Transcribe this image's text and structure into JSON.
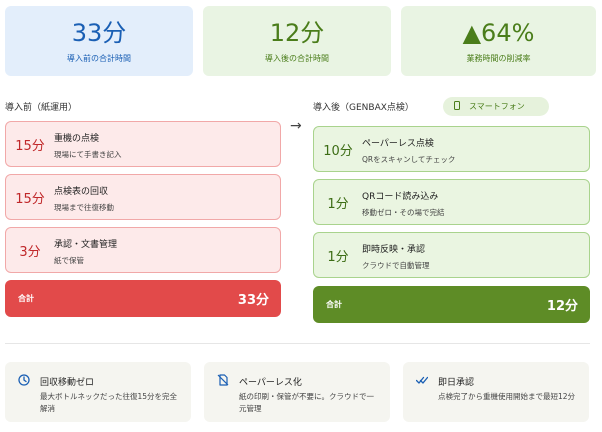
{
  "stats": {
    "before": {
      "value": "33分",
      "caption": "導入前の合計時間"
    },
    "after": {
      "value": "12分",
      "caption": "導入後の合計時間"
    },
    "rate": {
      "value": "▲64%",
      "caption": "業務時間の削減率"
    }
  },
  "before": {
    "title": "導入前（紙運用）",
    "steps": [
      {
        "minutes": "15分",
        "name": "重機の点検",
        "note": "現場にて手書き記入"
      },
      {
        "minutes": "15分",
        "name": "点検表の回収",
        "note": "現場まで往復移動"
      },
      {
        "minutes": "3分",
        "name": "承認・文書管理",
        "note": "紙で保管"
      }
    ],
    "total_label": "合計",
    "total_value": "33分"
  },
  "arrow": "→",
  "after": {
    "title": "導入後（GENBAX点検）",
    "badge": "スマートフォン",
    "steps": [
      {
        "minutes": "10分",
        "name": "ペーパーレス点検",
        "note": "QRをスキャンしてチェック"
      },
      {
        "minutes": "1分",
        "name": "QRコード読み込み",
        "note": "移動ゼロ・その場で完結"
      },
      {
        "minutes": "1分",
        "name": "即時反映・承認",
        "note": "クラウドで自動管理"
      }
    ],
    "total_label": "合計",
    "total_value": "12分"
  },
  "features": [
    {
      "icon": "clock-icon",
      "title": "回収移動ゼロ",
      "desc": "最大ボトルネックだった往復15分を完全解消"
    },
    {
      "icon": "no-paper-icon",
      "title": "ペーパーレス化",
      "desc": "紙の印刷・保管が不要に。クラウドで一元管理"
    },
    {
      "icon": "double-check-icon",
      "title": "即日承認",
      "desc": "点検完了から重機使用開始まで最短12分"
    }
  ],
  "colors": {
    "before_accent": "#e24a4a",
    "after_accent": "#5e8c26",
    "blue_accent": "#1a5fb4"
  }
}
